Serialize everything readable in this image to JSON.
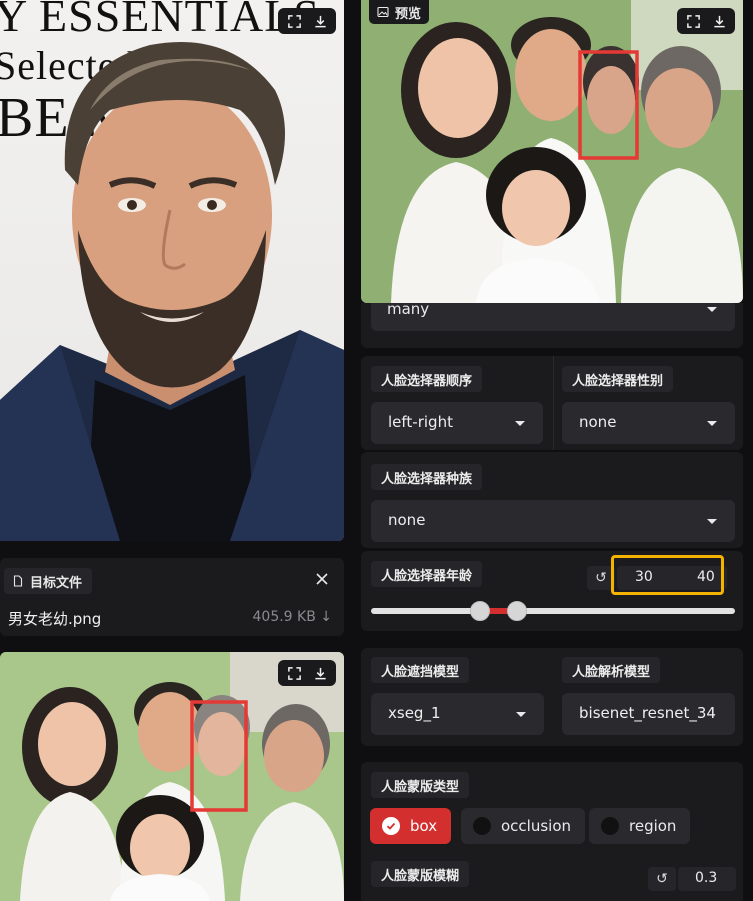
{
  "source_image": {
    "bg_text": [
      "Y ESSENTIALS",
      "Selected",
      "BE M"
    ],
    "tools": {
      "fullscreen_icon": "fullscreen-icon",
      "download_icon": "download-icon"
    }
  },
  "target_file": {
    "label": "目标文件",
    "file_name": "男女老幼.png",
    "file_size": "405.9 KB ↓"
  },
  "preview": {
    "label": "预览"
  },
  "face_selector_mode": {
    "value": "many"
  },
  "face_selector_order": {
    "label": "人脸选择器顺序",
    "value": "left-right"
  },
  "face_selector_gender": {
    "label": "人脸选择器性别",
    "value": "none"
  },
  "face_selector_race": {
    "label": "人脸选择器种族",
    "value": "none"
  },
  "face_selector_age": {
    "label": "人脸选择器年龄",
    "reset": "↺",
    "min": "30",
    "max": "40",
    "range_start": 0.3,
    "range_end": 0.4
  },
  "face_occluder_model": {
    "label": "人脸遮挡模型",
    "value": "xseg_1"
  },
  "face_parser_model": {
    "label": "人脸解析模型",
    "value": "bisenet_resnet_34"
  },
  "face_mask_types": {
    "label": "人脸蒙版类型",
    "options": [
      {
        "label": "box",
        "checked": true
      },
      {
        "label": "occlusion",
        "checked": false
      },
      {
        "label": "region",
        "checked": false
      }
    ]
  },
  "face_mask_blur": {
    "label": "人脸蒙版模糊",
    "reset": "↺",
    "value": "0.3"
  },
  "colors": {
    "accent_red": "#d32f2f",
    "highlight_yellow": "#f5b301",
    "panel": "#1b1b1e"
  }
}
